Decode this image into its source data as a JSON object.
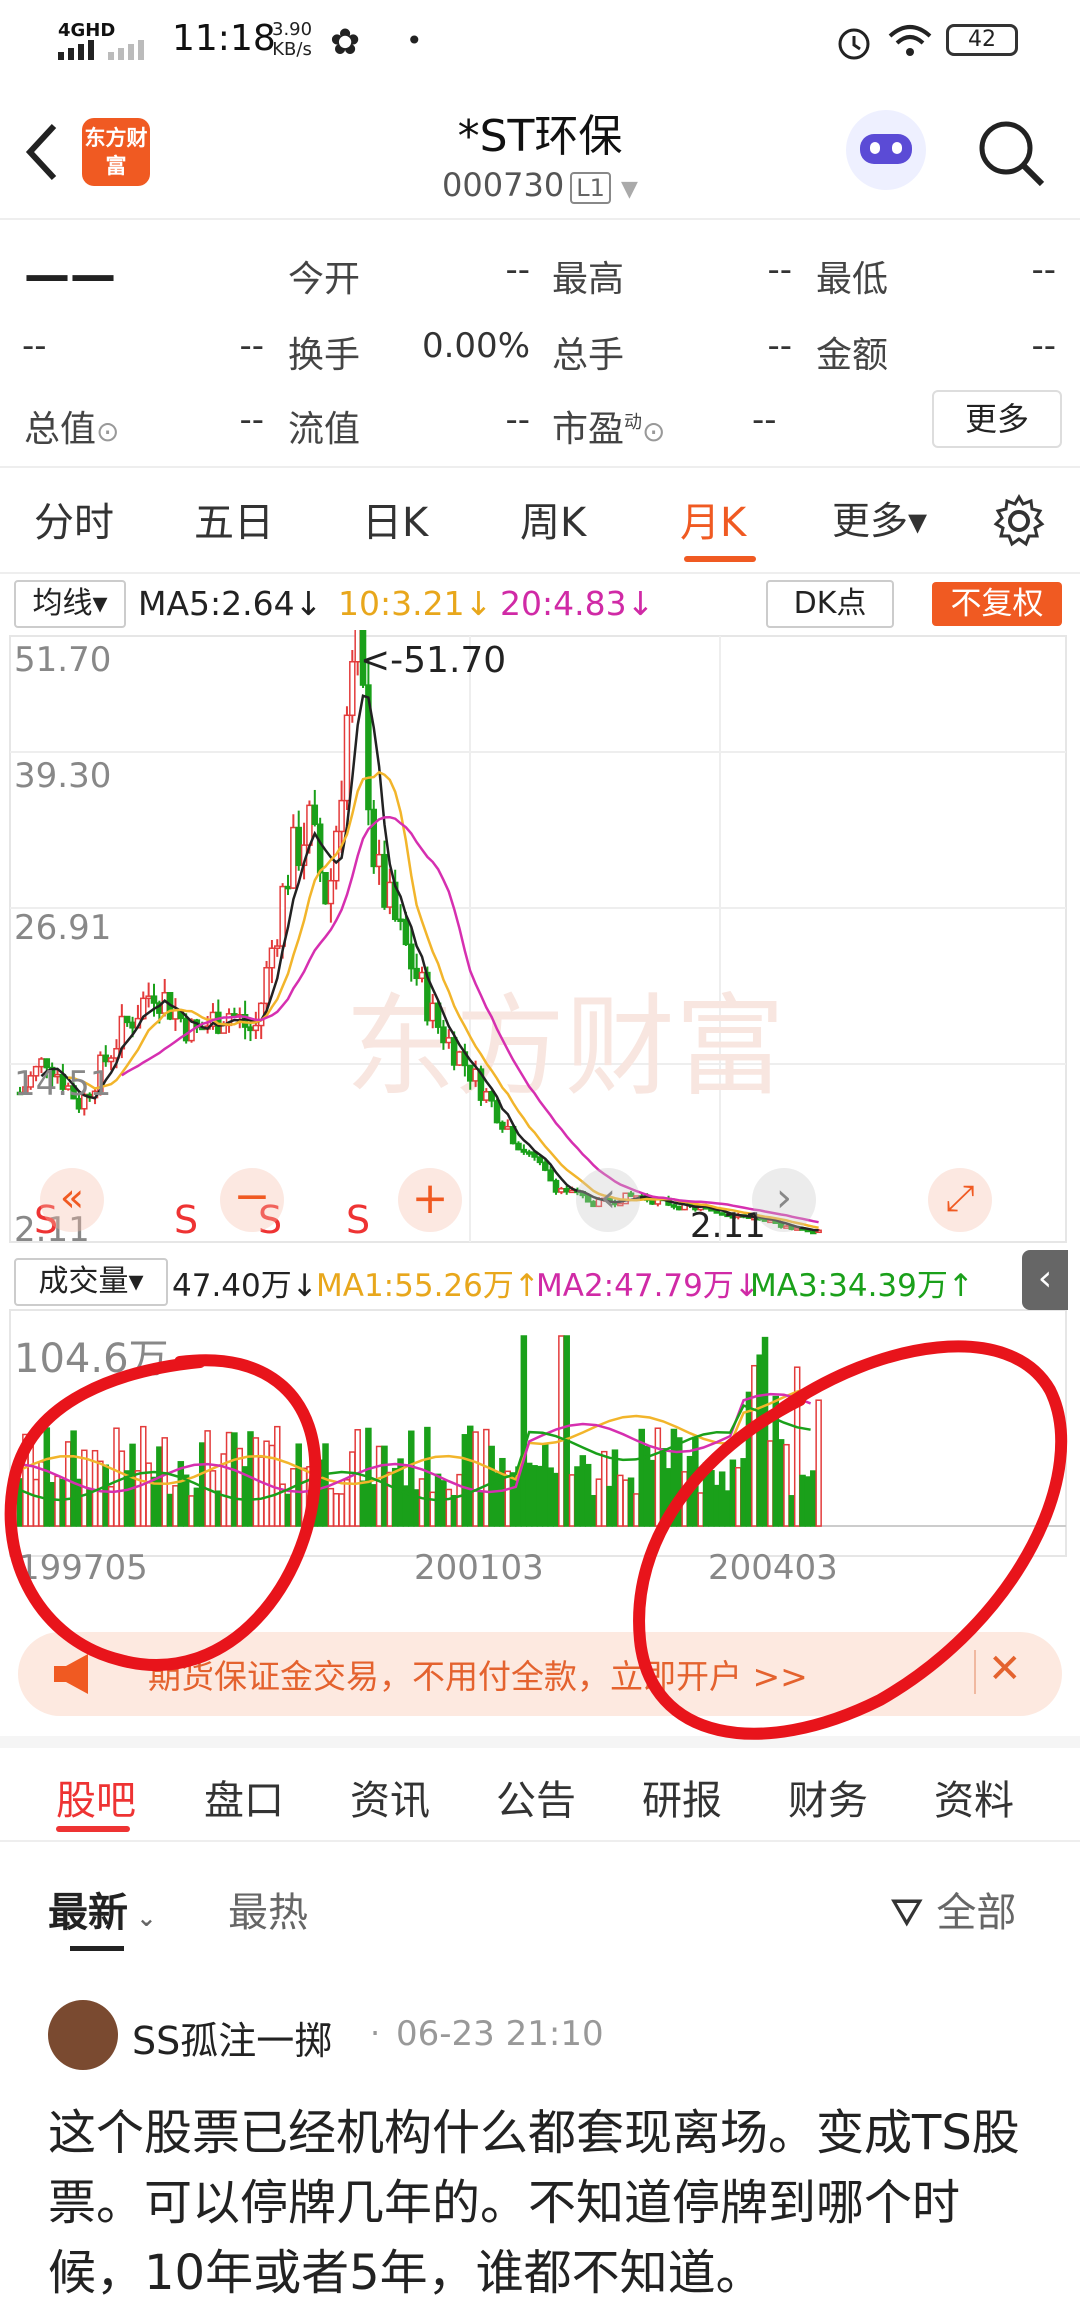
{
  "status": {
    "network": "4GHD",
    "time": "11:18",
    "speed": "3.90",
    "speed_unit": "KB/s",
    "battery": "42"
  },
  "header": {
    "back_label": "<",
    "logo": "东方财富",
    "title": "*ST环保",
    "code": "000730",
    "level": "L1"
  },
  "quote": {
    "price": "——",
    "change": "--",
    "change_pct": "--",
    "open_label": "今开",
    "open": "--",
    "high_label": "最高",
    "high": "--",
    "low_label": "最低",
    "low": "--",
    "turnover_label": "换手",
    "turnover": "0.00%",
    "volume_label": "总手",
    "volume": "--",
    "amount_label": "金额",
    "amount": "--",
    "mktcap_label": "总值",
    "mktcap": "--",
    "float_label": "流值",
    "float": "--",
    "pe_label": "市盈",
    "pe_sup": "动",
    "pe": "--",
    "more": "更多"
  },
  "ktabs": [
    {
      "label": "分时"
    },
    {
      "label": "五日"
    },
    {
      "label": "日K"
    },
    {
      "label": "周K"
    },
    {
      "label": "月K"
    },
    {
      "label": "更多▾"
    }
  ],
  "legend": {
    "ma_btn": "均线▾",
    "ma5": "MA5:2.64↓",
    "ma10": "10:3.21↓",
    "ma20": "20:4.83↓",
    "dk": "DK点",
    "fq": "不复权",
    "vol_btn": "成交量▾",
    "vol": "47.40万↓",
    "vma1": "MA1:55.26万↑",
    "vma2": "MA2:47.79万↓",
    "vma3": "MA3:34.39万↑"
  },
  "chart_data": {
    "type": "candlestick",
    "y_ticks": [
      "51.70",
      "39.30",
      "26.91",
      "14.51",
      "2.11"
    ],
    "max_label": "<-51.70",
    "min_label": "2.11",
    "vol_max": "104.6万",
    "x_ticks": [
      "199705",
      "200103",
      "200403"
    ],
    "ylim": [
      2.11,
      51.7
    ],
    "signals": [
      "S",
      "S",
      "S",
      "S"
    ],
    "colors": {
      "up": "#e33b3b",
      "down": "#1aa01a",
      "ma5": "#222222",
      "ma10": "#f2b52b",
      "ma20": "#d62fb0"
    }
  },
  "banner": {
    "text": "期货保证金交易，不用付全款，立即开户 >>",
    "close": "✕"
  },
  "btabs": [
    {
      "label": "股吧"
    },
    {
      "label": "盘口"
    },
    {
      "label": "资讯"
    },
    {
      "label": "公告"
    },
    {
      "label": "研报"
    },
    {
      "label": "财务"
    },
    {
      "label": "资料"
    }
  ],
  "subtabs": {
    "newest": "最新",
    "hot": "最热",
    "filter": "全部"
  },
  "post": {
    "user": "SS孤注一掷",
    "time": "06-23 21:10",
    "text": "这个股票已经机构什么都套现离场。变成TS股票。可以停牌几年的。不知道停牌到哪个时候，10年或者5年，谁都不知道。"
  }
}
